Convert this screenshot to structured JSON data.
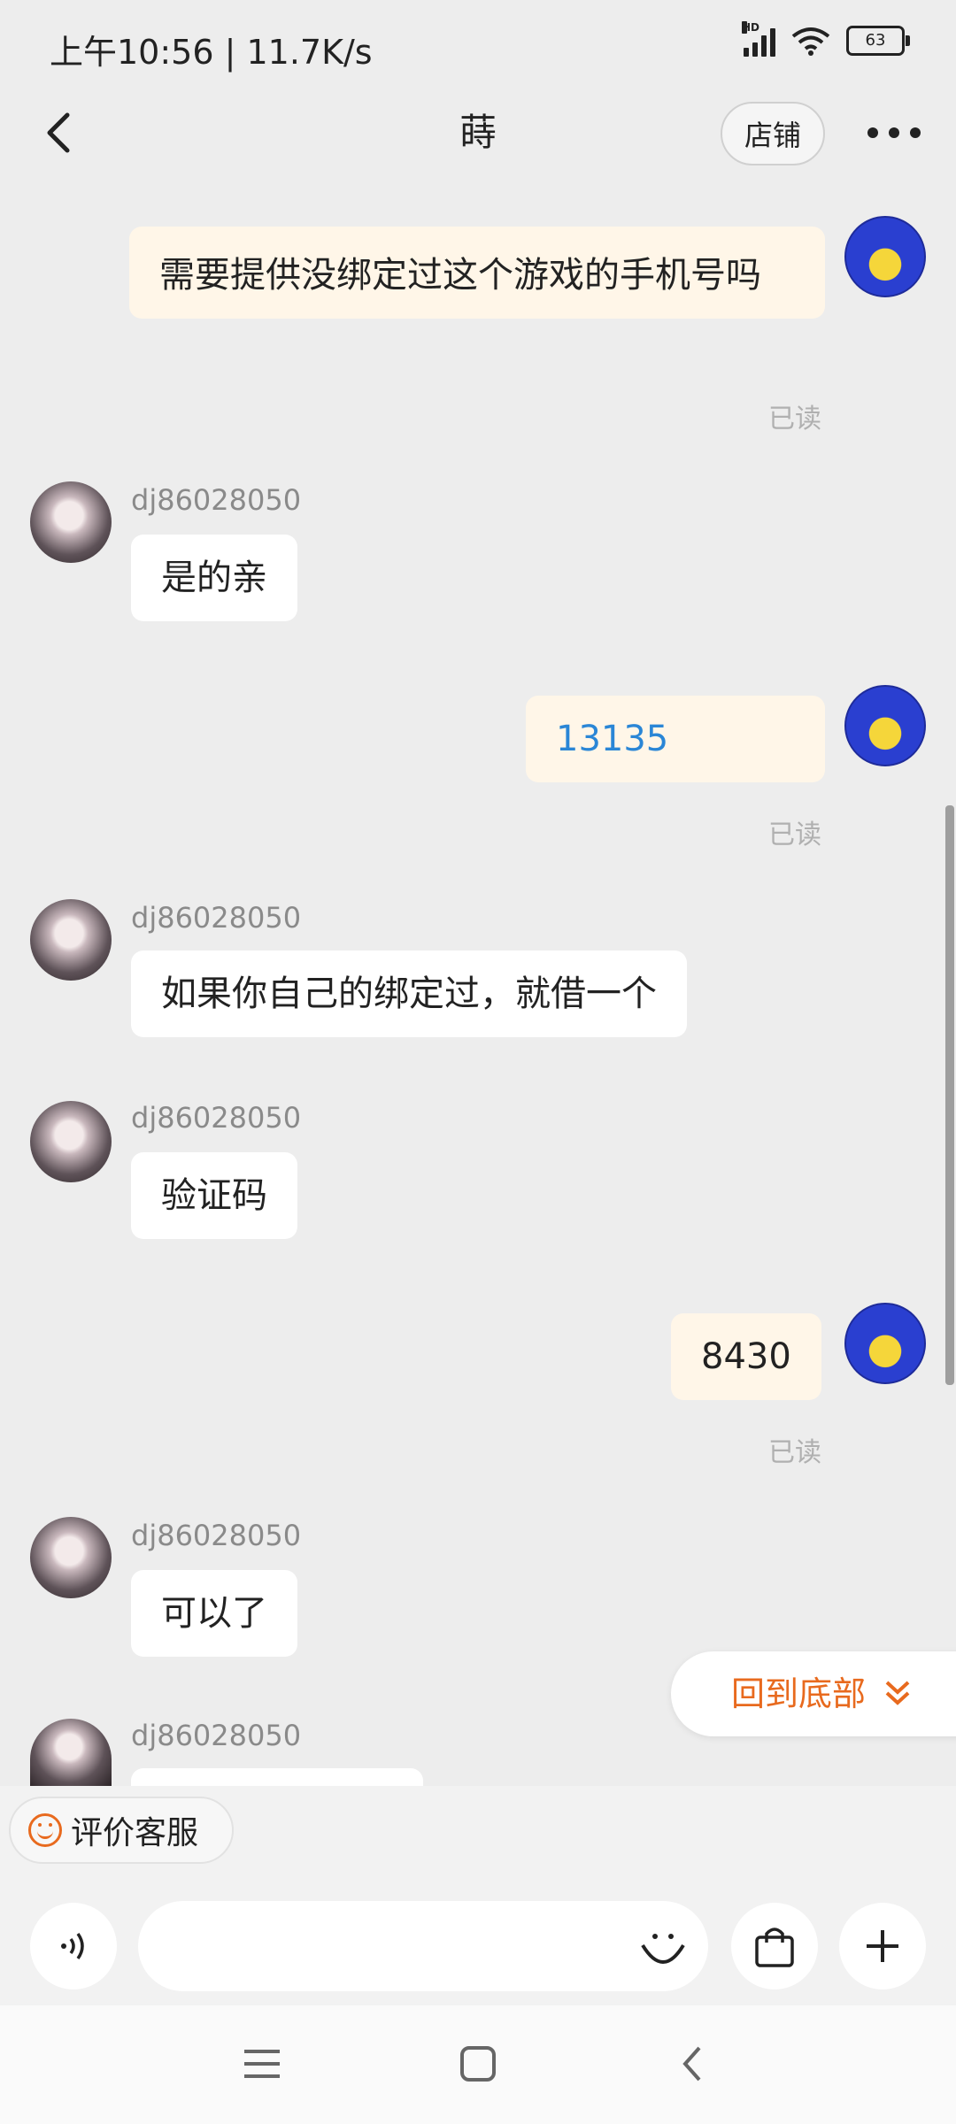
{
  "status_bar": {
    "time_speed": "上午10:56 | 11.7K/s",
    "network": "HD",
    "battery": "63"
  },
  "header": {
    "title": "蒔",
    "shop_button": "店铺"
  },
  "messages": [
    {
      "side": "mine",
      "text": "需要提供没绑定过这个游戏的手机号吗",
      "status": "已读"
    },
    {
      "side": "theirs",
      "sender": "dj86028050",
      "text": "是的亲"
    },
    {
      "side": "mine",
      "text": "13135",
      "status": "已读"
    },
    {
      "side": "theirs",
      "sender": "dj86028050",
      "text": "如果你自己的绑定过，就借一个"
    },
    {
      "side": "theirs",
      "sender": "dj86028050",
      "text": "验证码"
    },
    {
      "side": "mine",
      "text": "8430",
      "status": "已读"
    },
    {
      "side": "theirs",
      "sender": "dj86028050",
      "text": "可以了"
    },
    {
      "side": "theirs",
      "sender": "dj86028050",
      "text": ""
    }
  ],
  "back_to_bottom": "回到底部",
  "rate_service": "评价客服",
  "input": {
    "placeholder": ""
  },
  "icons": [
    "back-arrow-icon",
    "more-dots-icon",
    "voice-icon",
    "emoji-icon",
    "shopping-bag-icon",
    "plus-icon",
    "menu-icon",
    "home-square-icon",
    "back-chevron-icon",
    "chevron-double-down-icon"
  ],
  "colors": {
    "accent": "#e86a1e",
    "mine_bubble": "#fff6e8",
    "link_blue": "#2a86d6"
  }
}
